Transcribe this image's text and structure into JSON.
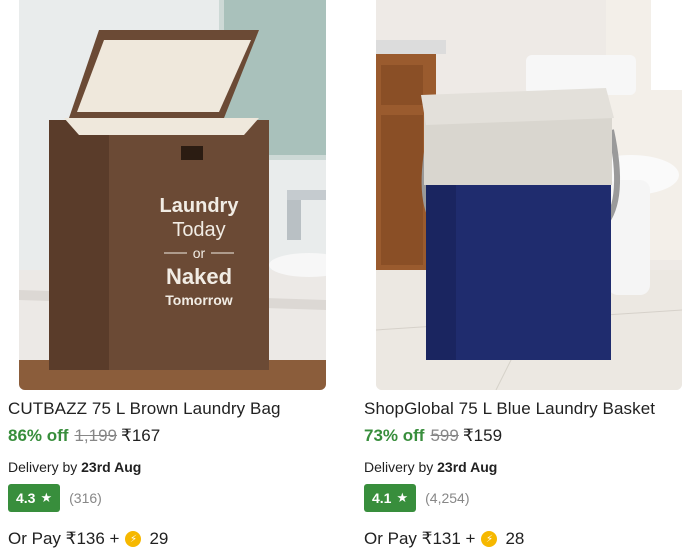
{
  "products": [
    {
      "title": "CUTBAZZ 75 L Brown Laundry Bag",
      "discount": "86% off",
      "mrp": "1,199",
      "price": "₹167",
      "delivery_prefix": "Delivery by",
      "delivery_date": "23rd Aug",
      "rating": "4.3",
      "rating_count": "(316)",
      "pay_prefix": "Or Pay ₹136 +",
      "coins": "29",
      "print": {
        "line1": "Laundry",
        "line2": "Today",
        "line3": "or",
        "line4": "Naked",
        "line5": "Tomorrow"
      },
      "image_icon": "laundry-bag-image"
    },
    {
      "title": "ShopGlobal 75 L Blue Laundry Basket",
      "discount": "73% off",
      "mrp": "599",
      "price": "₹159",
      "delivery_prefix": "Delivery by",
      "delivery_date": "23rd Aug",
      "rating": "4.1",
      "rating_count": "(4,254)",
      "pay_prefix": "Or Pay ₹131 +",
      "coins": "28",
      "image_icon": "laundry-basket-image"
    }
  ],
  "colors": {
    "discount_green": "#388e3c",
    "rating_badge": "#388e3c",
    "strike_grey": "#878787",
    "coin_gold": "#f6b800",
    "bag_brown": "#6b4a35",
    "basket_blue": "#1f2c6e"
  },
  "icons": {
    "star": "star-icon",
    "coin": "supercoin-icon"
  }
}
